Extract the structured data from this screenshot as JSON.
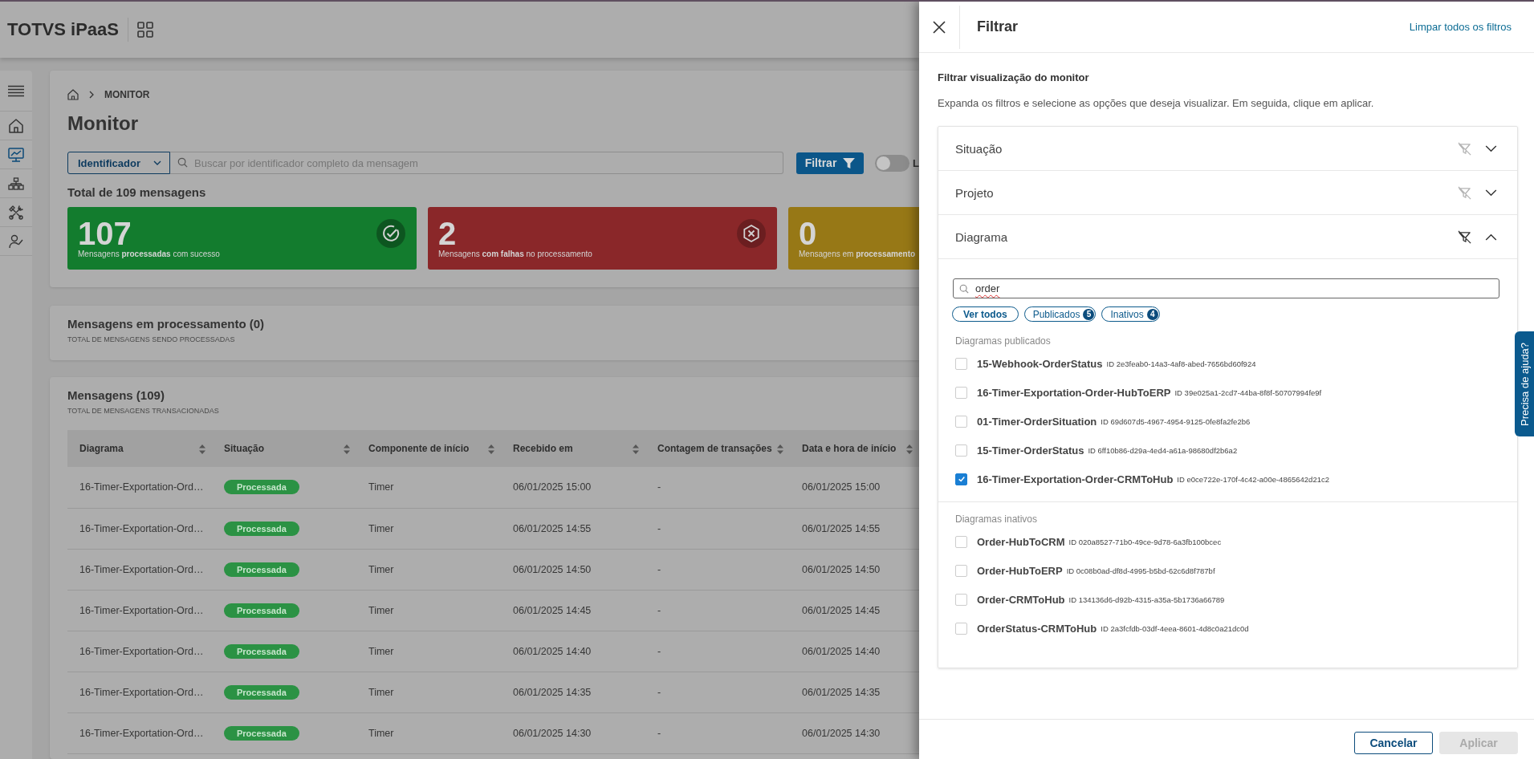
{
  "header": {
    "title": "TOTVS iPaaS"
  },
  "sidebar": {
    "items": [
      {
        "kind": "menu",
        "selected": false
      },
      {
        "kind": "home",
        "selected": false
      },
      {
        "kind": "monitor",
        "selected": true
      },
      {
        "kind": "diagram",
        "selected": false
      },
      {
        "kind": "tools",
        "selected": false
      },
      {
        "kind": "users",
        "selected": false
      }
    ]
  },
  "breadcrumb": {
    "current": "MONITOR"
  },
  "page_title": "Monitor",
  "search": {
    "select": "Identificador",
    "placeholder": "Buscar por identificador completo da mensagem",
    "button": "Filtrar",
    "toggle": {
      "on": false,
      "label": "L"
    }
  },
  "total": "Total de 109 mensagens",
  "stat_cards": [
    {
      "kind": "success",
      "color": "#137c2e",
      "value": "107",
      "caption": "Mensagens **processadas** com sucesso"
    },
    {
      "kind": "failure",
      "color": "#8a2729",
      "value": "2",
      "caption": "Mensagens **com falhas** no processamento"
    },
    {
      "kind": "pending",
      "color": "#977816",
      "value": "0",
      "caption": "Mensagens em **processamento**"
    }
  ],
  "processing_card": {
    "title": "Mensagens em processamento (0)",
    "subtitle": "TOTAL DE MENSAGENS SENDO PROCESSADAS"
  },
  "messages": {
    "title": "Mensagens (109)",
    "subtitle": "TOTAL DE MENSAGENS TRANSACIONADAS",
    "table": {
      "columns": [
        "Diagrama",
        "Situação",
        "Componente de início",
        "Recebido em",
        "Contagem de transações",
        "Data e hora de início"
      ],
      "rows": [
        {
          "diagram": "16-Timer-Exportation-Ord…",
          "status": "Processada",
          "component": "Timer",
          "received": "06/01/2025 15:00",
          "count": "-",
          "start": "06/01/2025 15:00"
        },
        {
          "diagram": "16-Timer-Exportation-Ord…",
          "status": "Processada",
          "component": "Timer",
          "received": "06/01/2025 14:55",
          "count": "-",
          "start": "06/01/2025 14:55"
        },
        {
          "diagram": "16-Timer-Exportation-Ord…",
          "status": "Processada",
          "component": "Timer",
          "received": "06/01/2025 14:50",
          "count": "-",
          "start": "06/01/2025 14:50"
        },
        {
          "diagram": "16-Timer-Exportation-Ord…",
          "status": "Processada",
          "component": "Timer",
          "received": "06/01/2025 14:45",
          "count": "-",
          "start": "06/01/2025 14:45"
        },
        {
          "diagram": "16-Timer-Exportation-Ord…",
          "status": "Processada",
          "component": "Timer",
          "received": "06/01/2025 14:40",
          "count": "-",
          "start": "06/01/2025 14:40"
        },
        {
          "diagram": "16-Timer-Exportation-Ord…",
          "status": "Processada",
          "component": "Timer",
          "received": "06/01/2025 14:35",
          "count": "-",
          "start": "06/01/2025 14:35"
        },
        {
          "diagram": "16-Timer-Exportation-Ord…",
          "status": "Processada",
          "component": "Timer",
          "received": "06/01/2025 14:30",
          "count": "-",
          "start": "06/01/2025 14:30"
        }
      ]
    }
  },
  "filter_panel": {
    "title": "Filtrar",
    "clear_link": "Limpar todos os filtros",
    "heading": "Filtrar visualização do monitor",
    "description": "Expanda os filtros e selecione as opções que deseja visualizar. Em seguida, clique em aplicar.",
    "sections": [
      {
        "label": "Situação",
        "expanded": false,
        "filter_active": false
      },
      {
        "label": "Projeto",
        "expanded": false,
        "filter_active": false
      },
      {
        "label": "Diagrama",
        "expanded": true,
        "filter_active": true,
        "search": {
          "value": "order",
          "misspelled": true
        },
        "chips": [
          {
            "label": "Ver todos",
            "selected": true
          },
          {
            "label": "Publicados",
            "count": "5",
            "selected": false
          },
          {
            "label": "Inativos",
            "count": "4",
            "selected": false
          }
        ],
        "groups": [
          {
            "title": "Diagramas publicados",
            "items": [
              {
                "name": "15-Webhook-OrderStatus",
                "id": "ID 2e3feab0-14a3-4af8-abed-7656bd60f924",
                "checked": false
              },
              {
                "name": "16-Timer-Exportation-Order-HubToERP",
                "id": "ID 39e025a1-2cd7-44ba-8f8f-50707994fe9f",
                "checked": false
              },
              {
                "name": "01-Timer-OrderSituation",
                "id": "ID 69d607d5-4967-4954-9125-0fe8fa2fe2b6",
                "checked": false
              },
              {
                "name": "15-Timer-OrderStatus",
                "id": "ID 6ff10b86-d29a-4ed4-a61a-98680df2b6a2",
                "checked": false
              },
              {
                "name": "16-Timer-Exportation-Order-CRMToHub",
                "id": "ID e0ce722e-170f-4c42-a00e-4865642d21c2",
                "checked": true
              }
            ]
          },
          {
            "title": "Diagramas inativos",
            "items": [
              {
                "name": "Order-HubToCRM",
                "id": "ID 020a8527-71b0-49ce-9d78-6a3fb100bcec",
                "checked": false
              },
              {
                "name": "Order-HubToERP",
                "id": "ID 0c08b0ad-df8d-4995-b5bd-62c6d8f787bf",
                "checked": false
              },
              {
                "name": "Order-CRMToHub",
                "id": "ID 134136d6-d92b-4315-a35a-5b1736a66789",
                "checked": false
              },
              {
                "name": "OrderStatus-CRMToHub",
                "id": "ID 2a3fcfdb-03df-4eea-8601-4d8c0a21dc0d",
                "checked": false
              }
            ]
          }
        ]
      }
    ],
    "buttons": [
      {
        "kind": "secondary",
        "label": "Cancelar",
        "disabled": false
      },
      {
        "kind": "primary",
        "label": "Aplicar",
        "disabled": true
      }
    ]
  },
  "help_tab": "Precisa de ajuda?"
}
